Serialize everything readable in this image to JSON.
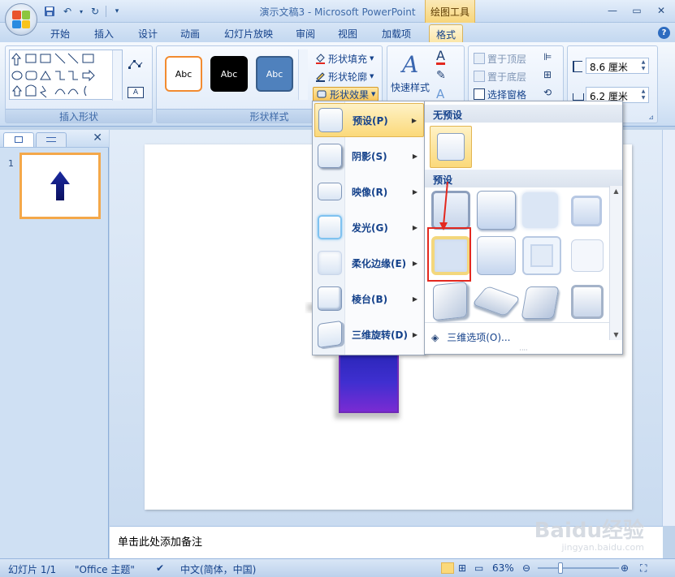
{
  "window": {
    "title": "演示文稿3 - Microsoft PowerPoint",
    "contextual_tab": "绘图工具"
  },
  "tabs": [
    "开始",
    "插入",
    "设计",
    "动画",
    "幻灯片放映",
    "审阅",
    "视图",
    "加载项",
    "格式"
  ],
  "ribbon": {
    "insert_shapes": {
      "label": "插入形状"
    },
    "shape_styles": {
      "label": "形状样式",
      "thumbs": [
        {
          "text": "Abc",
          "bg": "#ffffff",
          "fg": "#000000",
          "border": "#f28b30"
        },
        {
          "text": "Abc",
          "bg": "#000000",
          "fg": "#ffffff",
          "border": "#000000"
        },
        {
          "text": "Abc",
          "bg": "#4f81bd",
          "fg": "#ffffff",
          "border": "#385d8a"
        }
      ],
      "fill": "形状填充",
      "outline": "形状轮廓",
      "effects": "形状效果"
    },
    "quick_styles": "快速样式",
    "arrange": {
      "bring_front": "置于顶层",
      "send_back": "置于底层",
      "selection_pane": "选择窗格"
    },
    "size": {
      "height": "8.6 厘米",
      "width": "6.2 厘米"
    }
  },
  "effects_menu": {
    "items": [
      {
        "label": "预设(P)",
        "highlighted": true
      },
      {
        "label": "阴影(S)"
      },
      {
        "label": "映像(R)"
      },
      {
        "label": "发光(G)"
      },
      {
        "label": "柔化边缘(E)"
      },
      {
        "label": "棱台(B)"
      },
      {
        "label": "三维旋转(D)"
      }
    ]
  },
  "preset_submenu": {
    "no_preset_header": "无预设",
    "preset_header": "预设",
    "footer": "三维选项(O)..."
  },
  "slides_panel": {
    "slide_number": "1"
  },
  "notes": {
    "placeholder": "单击此处添加备注"
  },
  "status": {
    "slide": "幻灯片 1/1",
    "theme": "\"Office 主题\"",
    "language": "中文(简体，中国)",
    "zoom": "63%"
  },
  "colors": {
    "accent": "#15428b",
    "highlight": "#fbd97a",
    "arrow_top": "#2a26b8",
    "arrow_bottom": "#7b2bd3",
    "annotation": "#e3281f"
  },
  "watermark": {
    "brand": "Baidu经验",
    "url": "jingyan.baidu.com"
  }
}
